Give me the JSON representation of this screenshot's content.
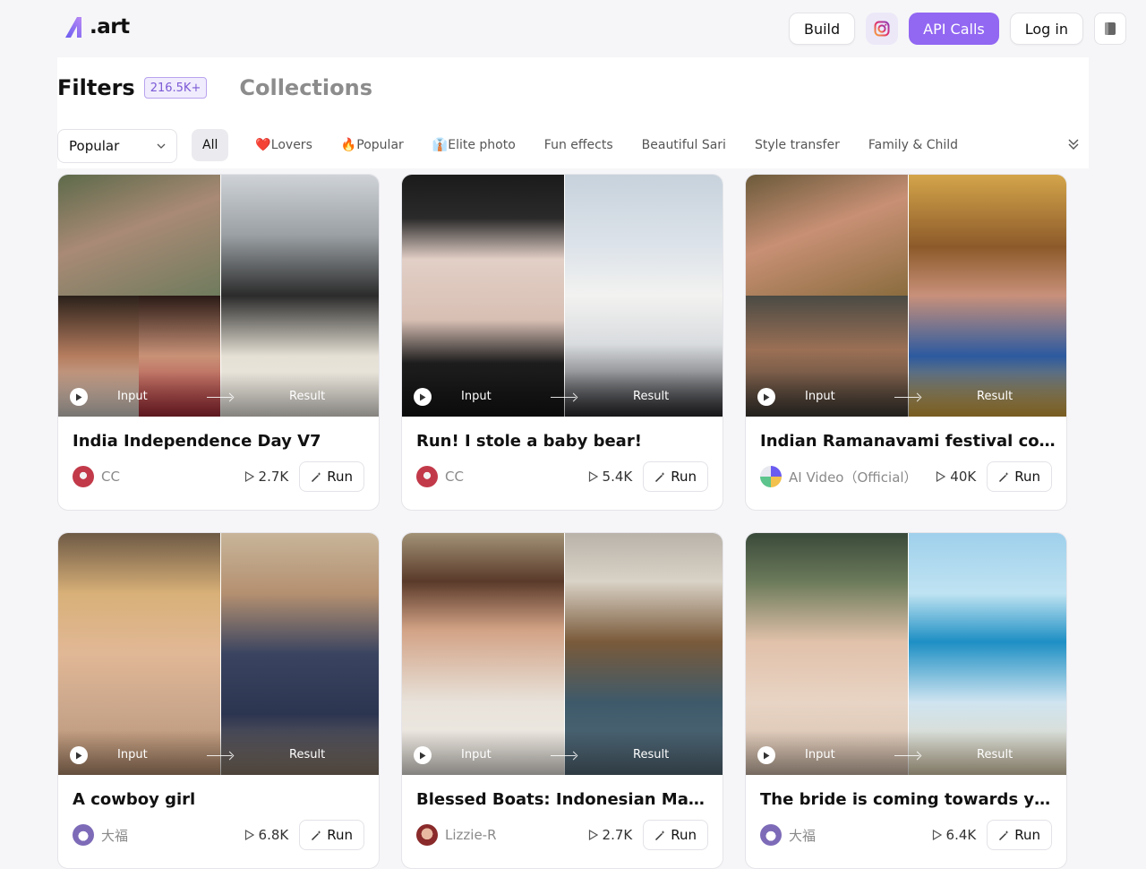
{
  "header": {
    "logo_text": ".art",
    "build_label": "Build",
    "api_label": "API Calls",
    "login_label": "Log in"
  },
  "tabs": {
    "filters": "Filters",
    "filters_count": "216.5K+",
    "collections": "Collections"
  },
  "sort": {
    "value": "Popular"
  },
  "chips": [
    "All",
    "❤️Lovers",
    "🔥Popular",
    "👔Elite photo",
    "Fun effects",
    "Beautiful Sari",
    "Style transfer",
    "Family & Child"
  ],
  "card_labels": {
    "input": "Input",
    "result": "Result",
    "run": "Run"
  },
  "cards": [
    {
      "title": "India Independence Day V7",
      "author": "CC",
      "runs": "2.7K"
    },
    {
      "title": "Run! I stole a baby bear!",
      "author": "CC",
      "runs": "5.4K"
    },
    {
      "title": "Indian Ramanavami festival couple",
      "author": "AI Video（Official）",
      "runs": "40K"
    },
    {
      "title": "A cowboy girl",
      "author": "大福",
      "runs": "6.8K"
    },
    {
      "title": "Blessed Boats: Indonesian Mawlid Festival",
      "author": "Lizzie-R",
      "runs": "2.7K"
    },
    {
      "title": "The bride is coming towards you",
      "author": "大福",
      "runs": "6.4K"
    }
  ],
  "colors": {
    "accent": "#9267f2",
    "badge_text": "#7b5ad6"
  }
}
